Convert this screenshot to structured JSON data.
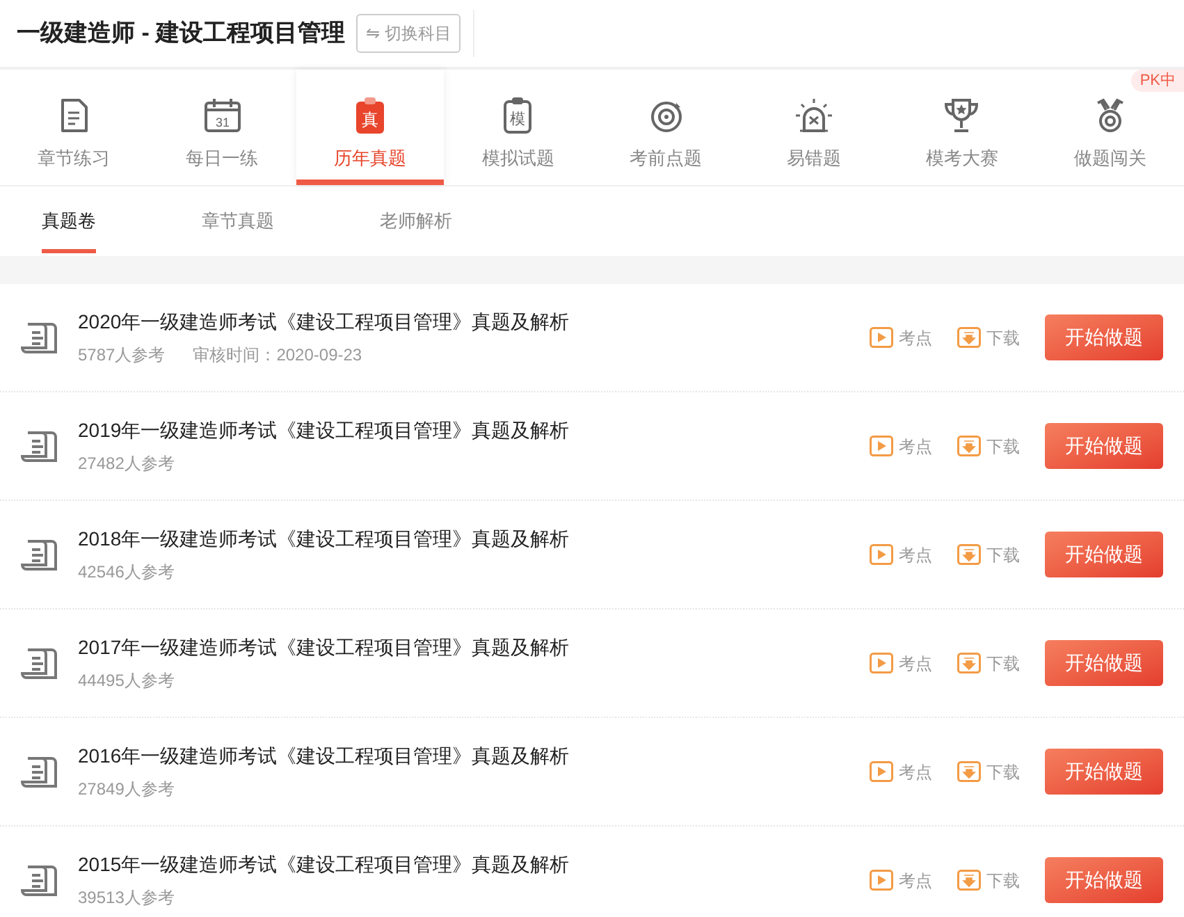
{
  "header": {
    "title": "一级建造师 - 建设工程项目管理",
    "switch_button": "⇋ 切换科目"
  },
  "nav": [
    {
      "label": "章节练习",
      "kind": "doc",
      "selected": false
    },
    {
      "label": "每日一练",
      "kind": "calendar",
      "icon_text": "31",
      "selected": false
    },
    {
      "label": "历年真题",
      "kind": "clipboard",
      "icon_text": "真",
      "selected": true
    },
    {
      "label": "模拟试题",
      "kind": "clipboard",
      "icon_text": "模",
      "selected": false
    },
    {
      "label": "考前点题",
      "kind": "target",
      "selected": false
    },
    {
      "label": "易错题",
      "kind": "alarm",
      "selected": false
    },
    {
      "label": "模考大赛",
      "kind": "trophy",
      "selected": false
    },
    {
      "label": "做题闯关",
      "kind": "medal",
      "badge": "PK中",
      "selected": false
    }
  ],
  "subtabs": [
    {
      "label": "真题卷",
      "selected": true
    },
    {
      "label": "章节真题",
      "selected": false
    },
    {
      "label": "老师解析",
      "selected": false
    }
  ],
  "papers": [
    {
      "title": "2020年一级建造师考试《建设工程项目管理》真题及解析",
      "count": "5787人参考",
      "review": "审核时间：2020-09-23",
      "points": "考点",
      "download": "下载",
      "start": "开始做题"
    },
    {
      "title": "2019年一级建造师考试《建设工程项目管理》真题及解析",
      "count": "27482人参考",
      "points": "考点",
      "download": "下载",
      "start": "开始做题"
    },
    {
      "title": "2018年一级建造师考试《建设工程项目管理》真题及解析",
      "count": "42546人参考",
      "points": "考点",
      "download": "下载",
      "start": "开始做题"
    },
    {
      "title": "2017年一级建造师考试《建设工程项目管理》真题及解析",
      "count": "44495人参考",
      "points": "考点",
      "download": "下载",
      "start": "开始做题"
    },
    {
      "title": "2016年一级建造师考试《建设工程项目管理》真题及解析",
      "count": "27849人参考",
      "points": "考点",
      "download": "下载",
      "start": "开始做题"
    },
    {
      "title": "2015年一级建造师考试《建设工程项目管理》真题及解析",
      "count": "39513人参考",
      "points": "考点",
      "download": "下载",
      "start": "开始做题"
    }
  ]
}
